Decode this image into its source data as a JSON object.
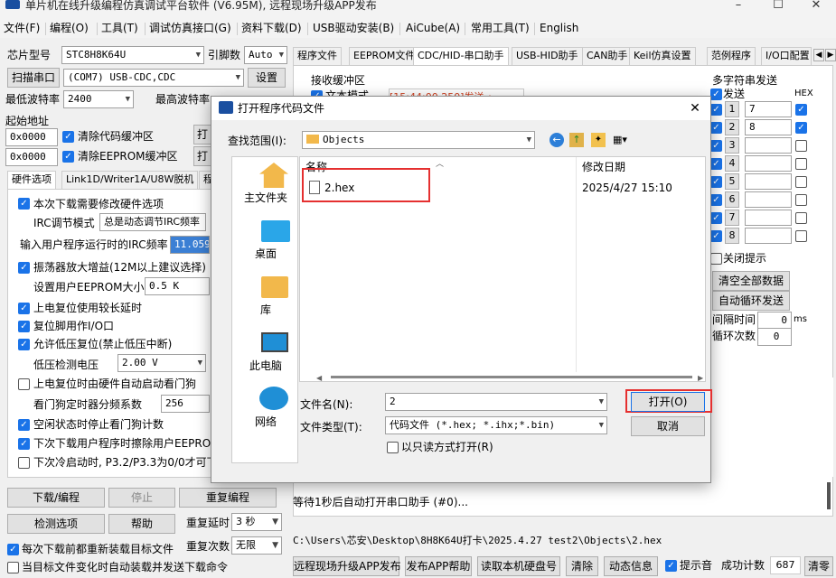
{
  "app": {
    "title": "单片机在线升级编程仿真调试平台软件 (V6.95M), 远程现场升级APP发布",
    "minimize": "–",
    "maximize": "☐",
    "close": "✕"
  },
  "menu": [
    "文件(F)",
    "编程(O)",
    "工具(T)",
    "调试仿真接口(G)",
    "资料下载(D)",
    "USB驱动安装(B)",
    "AiCube(A)",
    "常用工具(T)",
    "English"
  ],
  "left": {
    "chip_label": "芯片型号",
    "chip_value": "STC8H8K64U",
    "pin_label": "引脚数",
    "pin_value": "Auto",
    "scan_button": "扫描串口",
    "port_value": "(COM7) USB-CDC,CDC",
    "settings_button": "设置",
    "min_baud_label": "最低波特率",
    "min_baud_value": "2400",
    "max_baud_label": "最高波特率",
    "start_addr_label": "起始地址",
    "addr1": "0x0000",
    "clear_code": "清除代码缓冲区",
    "addr2": "0x0000",
    "clear_eeprom": "清除EEPROM缓冲区",
    "open_btn_1": "打",
    "open_btn_2": "打",
    "tabs": [
      "硬件选项",
      "Link1D/Writer1A/U8W脱机",
      "程"
    ],
    "opt_modify_hw": "本次下载需要修改硬件选项",
    "irc_mode_label": "IRC调节模式",
    "irc_mode_value": "总是动态调节IRC频率",
    "irc_freq_label": "输入用户程序运行时的IRC频率",
    "irc_freq_value": "11.0592",
    "opt_osc_gain": "振荡器放大增益(12M以上建议选择)",
    "eeprom_size_label": "设置用户EEPROM大小",
    "eeprom_size_value": "0.5 K",
    "opt_long_delay": "上电复位使用较长延时",
    "opt_reset_pin": "复位脚用作I/O口",
    "opt_lvr": "允许低压复位(禁止低压中断)",
    "lvd_label": "低压检测电压",
    "lvd_value": "2.00 V",
    "opt_wdt_auto": "上电复位时由硬件自动启动看门狗",
    "wdt_div_label": "看门狗定时器分频系数",
    "wdt_div_value": "256",
    "opt_idle_wdt": "空闲状态时停止看门狗计数",
    "opt_erase_eeprom": "下次下载用户程序时擦除用户EEPROM[",
    "opt_cold_boot": "下次冷启动时, P3.2/P3.3为0/0才可下",
    "download_button": "下载/编程",
    "stop_button": "停止",
    "reprogram_button": "重复编程",
    "detect_button": "检测选项",
    "help_button": "帮助",
    "repeat_delay_label": "重复延时",
    "repeat_delay_value": "3 秒",
    "repeat_count_label": "重复次数",
    "repeat_count_value": "无限",
    "opt_reload": "每次下载前都重新装载目标文件",
    "opt_auto_load": "当目标文件变化时自动装载并发送下载命令"
  },
  "right": {
    "tabs": [
      "程序文件",
      "EEPROM文件",
      "CDC/HID-串口助手",
      "USB-HID助手",
      "CAN助手",
      "Keil仿真设置",
      "范例程序",
      "I/O口配置"
    ],
    "recv_label": "接收缓冲区",
    "text_mode": "文本模式",
    "recv_line": "[15:44:00.250]发送→",
    "multi_send_label": "多字符串发送",
    "send_col": "发送",
    "hex_col": "HEX",
    "multi_rows": [
      {
        "n": "1",
        "v": "7",
        "hex": true
      },
      {
        "n": "2",
        "v": "8",
        "hex": true
      },
      {
        "n": "3",
        "v": "",
        "hex": false
      },
      {
        "n": "4",
        "v": "",
        "hex": false
      },
      {
        "n": "5",
        "v": "",
        "hex": false
      },
      {
        "n": "6",
        "v": "",
        "hex": false
      },
      {
        "n": "7",
        "v": "",
        "hex": false
      },
      {
        "n": "8",
        "v": "",
        "hex": false
      }
    ],
    "close_hint": "关闭提示",
    "clear_all": "清空全部数据",
    "auto_loop": "自动循环发送",
    "interval_label": "间隔时间",
    "interval_value": "0",
    "interval_unit": "ms",
    "loop_count_label": "循环次数",
    "loop_count_value": "0",
    "wait_msg": "等待1秒后自动打开串口助手 (#0)...",
    "path": "C:\\Users\\芯安\\Desktop\\8H8K64U打卡\\2025.4.27 test2\\Objects\\2.hex",
    "bottom_buttons": [
      "远程现场升级APP发布",
      "发布APP帮助",
      "读取本机硬盘号",
      "清除",
      "动态信息"
    ],
    "sound_label": "提示音",
    "success_label": "成功计数",
    "success_value": "687",
    "clear_label": "清零"
  },
  "dialog": {
    "title": "打开程序代码文件",
    "close": "✕",
    "lookin_label": "查找范围(I):",
    "lookin_value": "Objects",
    "places": [
      "主文件夹",
      "桌面",
      "库",
      "此电脑",
      "网络"
    ],
    "col_name": "名称",
    "col_date": "修改日期",
    "files": [
      {
        "name": "2.hex",
        "date": "2025/4/27 15:10"
      }
    ],
    "filename_label": "文件名(N):",
    "filename_value": "2",
    "filetype_label": "文件类型(T):",
    "filetype_value": "代码文件 (*.hex; *.ihx;*.bin)",
    "readonly_label": "以只读方式打开(R)",
    "open_button": "打开(O)",
    "cancel_button": "取消"
  }
}
